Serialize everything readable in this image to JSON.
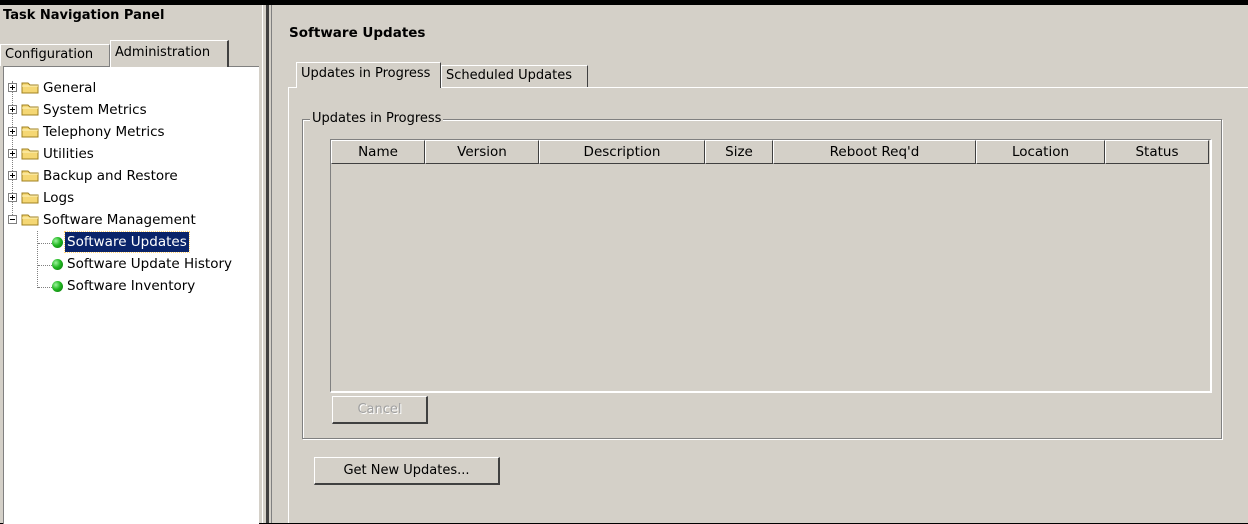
{
  "nav": {
    "title": "Task Navigation Panel",
    "tabs": [
      {
        "label": "Configuration",
        "active": false
      },
      {
        "label": "Administration",
        "active": true
      }
    ],
    "tree": [
      {
        "label": "General",
        "expander": "plus"
      },
      {
        "label": "System Metrics",
        "expander": "plus"
      },
      {
        "label": "Telephony Metrics",
        "expander": "plus"
      },
      {
        "label": "Utilities",
        "expander": "plus"
      },
      {
        "label": "Backup and Restore",
        "expander": "plus"
      },
      {
        "label": "Logs",
        "expander": "plus"
      },
      {
        "label": "Software Management",
        "expander": "minus",
        "children": [
          {
            "label": "Software Updates",
            "selected": true
          },
          {
            "label": "Software Update History",
            "selected": false
          },
          {
            "label": "Software Inventory",
            "selected": false
          }
        ]
      }
    ]
  },
  "main": {
    "title": "Software Updates",
    "tabs": [
      {
        "label": "Updates in Progress",
        "active": true
      },
      {
        "label": "Scheduled Updates",
        "active": false
      }
    ],
    "group_label": "Updates in Progress",
    "table": {
      "columns": [
        "Name",
        "Version",
        "Description",
        "Size",
        "Reboot Req'd",
        "Location",
        "Status"
      ],
      "rows": []
    },
    "cancel_label": "Cancel",
    "get_updates_label": "Get New Updates..."
  },
  "colors": {
    "background": "#d4d0c8",
    "selection": "#0a246a",
    "status_dot": "#22b822",
    "folder": "#f5d774"
  }
}
